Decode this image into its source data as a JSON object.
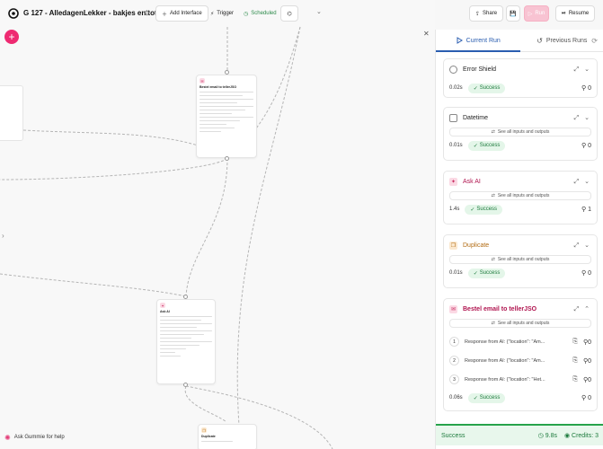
{
  "app": {
    "title": "G 127 - AlledagenLekker - bakjes en tot...",
    "toolbar": {
      "add_interface": "Add Interface",
      "trigger": "Trigger",
      "scheduled": "Scheduled",
      "share": "Share",
      "run": "Run",
      "resume": "Resume"
    },
    "ask_gummie": "Ask Gummie for help"
  },
  "canvas": {
    "nodes": [
      {
        "title": "Bestel email to tellerJSO"
      },
      {
        "title": "Ask AI"
      },
      {
        "title": "Duplicate"
      }
    ]
  },
  "panel": {
    "tabs": [
      {
        "label": "Current Run"
      },
      {
        "label": "Previous Runs"
      }
    ],
    "see_all": "See all inputs and outputs",
    "runs": [
      {
        "name": "Error Shield",
        "time": "0.02s",
        "status": "Success",
        "count": "0"
      },
      {
        "name": "Datetime",
        "time": "0.01s",
        "status": "Success",
        "count": "0"
      },
      {
        "name": "Ask AI",
        "time": "1.4s",
        "status": "Success",
        "count": "1"
      },
      {
        "name": "Duplicate",
        "time": "0.01s",
        "status": "Success",
        "count": "0"
      },
      {
        "name": "Bestel email to tellerJSO",
        "time": "0.06s",
        "status": "Success",
        "count": "0",
        "responses": [
          {
            "n": "1",
            "text": "Response from AI: {\"location\": \"Am...",
            "count": "0"
          },
          {
            "n": "2",
            "text": "Response from AI: {\"location\": \"Am...",
            "count": "0"
          },
          {
            "n": "3",
            "text": "Response from AI: {\"location\": \"Het...",
            "count": "0"
          }
        ]
      }
    ],
    "footer": {
      "status": "Success",
      "time": "9.8s",
      "credits": "Credits: 3"
    }
  },
  "colors": {
    "accent": "#ee2a71",
    "success": "#26a34a",
    "link": "#2a5db0"
  }
}
